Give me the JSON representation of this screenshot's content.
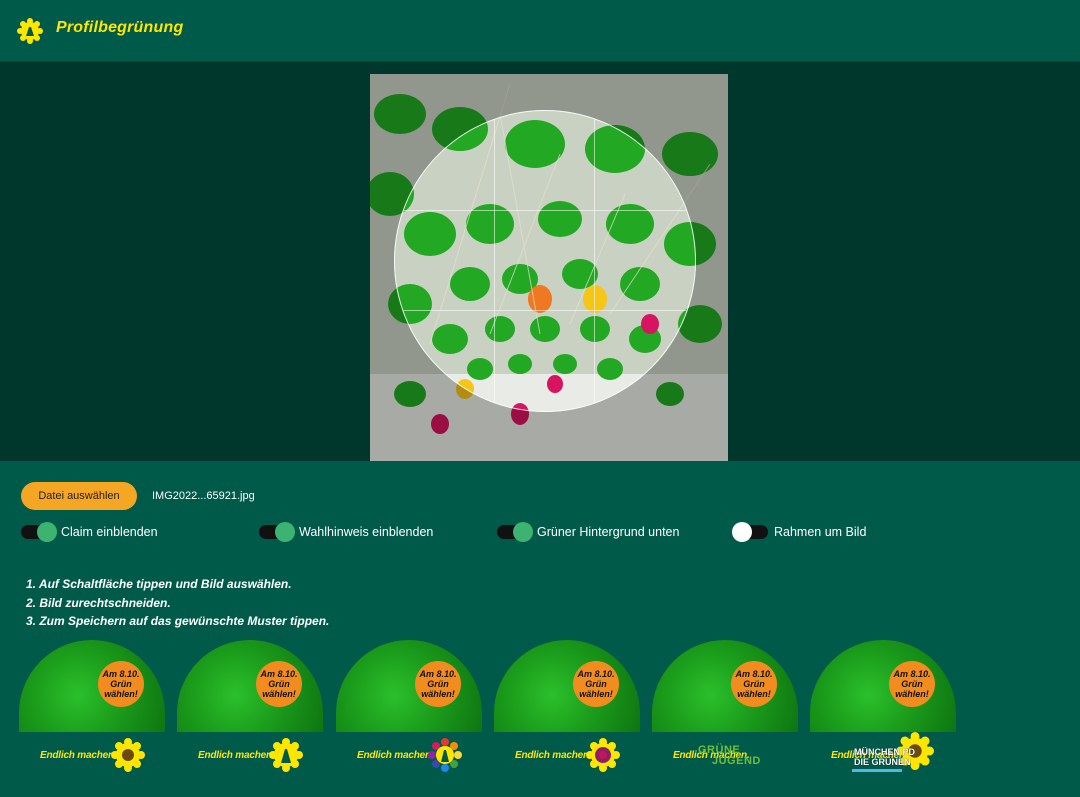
{
  "header": {
    "title": "Profilbegrünung",
    "logo_icon": "sunflower-logo-icon"
  },
  "editor": {
    "image_alt": "balloons photo"
  },
  "file": {
    "button_label": "Datei auswählen",
    "file_name": "IMG2022...65921.jpg"
  },
  "toggles": [
    {
      "label": "Claim einblenden",
      "state": true
    },
    {
      "label": "Wahlhinweis einblenden",
      "state": true
    },
    {
      "label": "Grüner Hintergrund unten",
      "state": true
    },
    {
      "label": "Rahmen um Bild",
      "state": false
    }
  ],
  "instructions": [
    "1. Auf Schaltfläche tippen und Bild auswählen.",
    "2. Bild zurechtschneiden.",
    "3. Zum Speichern auf das gewünschte Muster tippen."
  ],
  "thumbnails": {
    "badge_line1": "Am 8.10.",
    "badge_line2": "Grün",
    "badge_line3": "wählen!",
    "claim": "Endlich machen.",
    "items": [
      {
        "variant": "sunflower",
        "mark_icon": "sunflower-icon"
      },
      {
        "variant": "logo",
        "mark_icon": "party-logo-icon"
      },
      {
        "variant": "rainbow",
        "mark_icon": "rainbow-sunflower-icon"
      },
      {
        "variant": "purple-sunflower",
        "mark_icon": "purple-sunflower-icon"
      },
      {
        "variant": "gruene-jugend",
        "mark_icon": "gruene-jugend-logo-icon",
        "overlay_line1": "GRÜNE",
        "overlay_line2": "JUGEND"
      },
      {
        "variant": "muenchen",
        "mark_icon": "sunflower-icon",
        "overlay_line1": "MÜNCHEN PD",
        "overlay_line2": "DIE GRÜNEN"
      }
    ]
  },
  "colors": {
    "topbar": "#005a4a",
    "editor_bg": "#00372d",
    "brand_yellow": "#ffe600",
    "button_orange": "#f5a623",
    "toggle_on": "#3cb371",
    "badge_orange": "#f28c1e"
  }
}
